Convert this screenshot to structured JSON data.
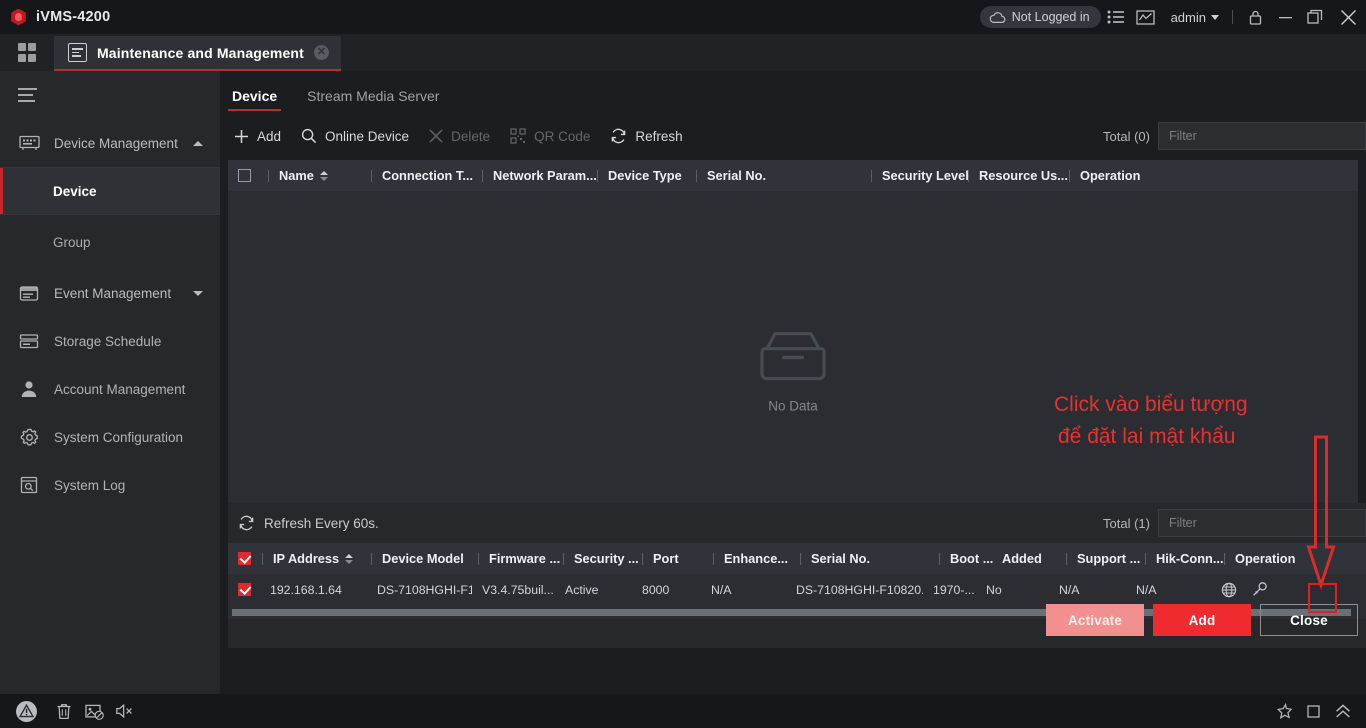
{
  "titlebar": {
    "app_name": "iVMS-4200",
    "logo_icon": "hexagon-logo-icon",
    "login_status": "Not Logged in",
    "cloud_icon": "cloud-icon",
    "list_icon": "task-list-icon",
    "chart_icon": "statistics-chart-icon",
    "user_name": "admin",
    "user_caret_icon": "chevron-down-icon",
    "lock_icon": "lock-icon",
    "minimize_icon": "minimize-icon",
    "maximize_icon": "restore-icon",
    "close_icon": "close-icon"
  },
  "tabbar": {
    "grid_icon": "app-grid-icon",
    "tab_icon": "maintenance-icon",
    "tab_label": "Maintenance and Management",
    "tab_close_icon": "close-icon",
    "accent_color": "#c5272d"
  },
  "sidebar": {
    "hamburger_icon": "hamburger-menu-icon",
    "items": [
      {
        "label": "Device Management",
        "icon": "device-management-icon",
        "caret": "up",
        "type": "group"
      },
      {
        "label": "Device",
        "icon": "",
        "type": "sub",
        "active": true
      },
      {
        "label": "Group",
        "icon": "",
        "type": "sub",
        "active": false
      },
      {
        "label": "Event Management",
        "icon": "event-management-icon",
        "caret": "down",
        "type": "group"
      },
      {
        "label": "Storage Schedule",
        "icon": "storage-schedule-icon",
        "type": "item"
      },
      {
        "label": "Account Management",
        "icon": "account-management-icon",
        "type": "item"
      },
      {
        "label": "System Configuration",
        "icon": "gear-icon",
        "type": "item"
      },
      {
        "label": "System Log",
        "icon": "system-log-icon",
        "type": "item"
      }
    ]
  },
  "main": {
    "sub_tabs": [
      {
        "label": "Device",
        "active": true
      },
      {
        "label": "Stream Media Server",
        "active": false
      }
    ],
    "toolbar": [
      {
        "label": "Add",
        "icon": "plus-icon",
        "disabled": false
      },
      {
        "label": "Online Device",
        "icon": "search-icon",
        "disabled": false
      },
      {
        "label": "Delete",
        "icon": "close-x-icon",
        "disabled": true
      },
      {
        "label": "QR Code",
        "icon": "qr-code-icon",
        "disabled": true
      },
      {
        "label": "Refresh",
        "icon": "refresh-icon",
        "disabled": false
      }
    ],
    "total_label": "Total (0)",
    "filter_placeholder": "Filter",
    "filter_value": "",
    "table_headers": [
      "Name",
      "Connection T...",
      "Network Param...",
      "Device Type",
      "Serial No.",
      "Security Level",
      "Resource Us...",
      "Operation"
    ],
    "empty_icon": "empty-box-icon",
    "empty_label": "No Data"
  },
  "annotation": {
    "line1": "Click vào biểu tượng",
    "line2": "để đặt lai mật khẩu",
    "color": "#e8322e",
    "arrow_icon": "down-arrow-annotation-icon",
    "highlight_icon": "red-highlight-box"
  },
  "online_panel": {
    "refresh_icon": "refresh-icon",
    "refresh_label": "Refresh Every 60s.",
    "total_label": "Total (1)",
    "filter_placeholder": "Filter",
    "filter_value": "",
    "headers": [
      "IP Address",
      "Device Model",
      "Firmware ...",
      "Security ...",
      "Port",
      "Enhance...",
      "Serial No.",
      "Boot ...",
      "Added",
      "Support ...",
      "Hik-Conn...",
      "Operation"
    ],
    "rows": [
      {
        "selected": true,
        "ip_address": "192.168.1.64",
        "device_model": "DS-7108HGHI-F1",
        "firmware": "V3.4.75buil...",
        "security": "Active",
        "port": "8000",
        "enhanced_sdk": "N/A",
        "serial_no": "DS-7108HGHI-F10820...",
        "boot_time": "1970-...",
        "added": "No",
        "support": "N/A",
        "hik_connect": "N/A",
        "operation_icons": [
          "globe-icon",
          "key-reset-password-icon"
        ]
      }
    ],
    "scrollbar": "horizontal-scrollbar"
  },
  "buttons": {
    "activate": "Activate",
    "add": "Add",
    "close": "Close",
    "activate_color": "#f28f8f",
    "add_color": "#ef2b2f"
  },
  "statusbar": {
    "warning_icon": "warning-icon",
    "trash_icon": "trash-icon",
    "image_block_icon": "image-disabled-icon",
    "mute_icon": "speaker-mute-icon",
    "pin_icon": "pin-icon",
    "square_icon": "square-icon",
    "collapse_icon": "double-chevron-up-icon"
  }
}
